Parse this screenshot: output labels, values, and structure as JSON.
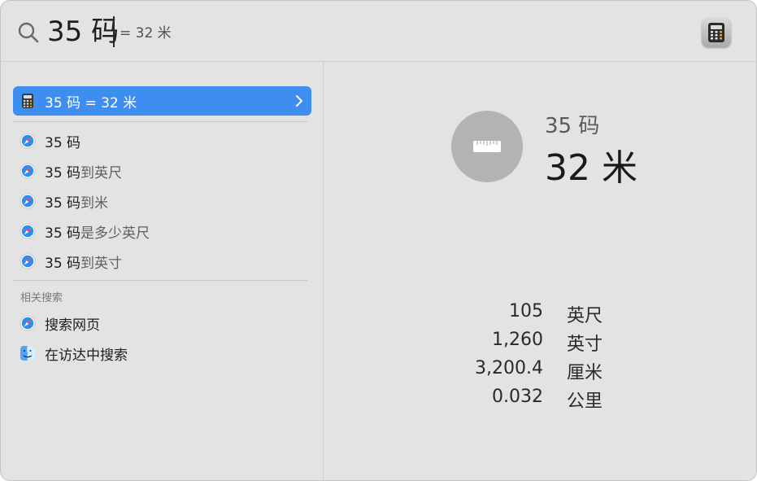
{
  "search": {
    "query": "35 码",
    "inline_result": "= 32 米"
  },
  "top_result": {
    "label": "35 码 = 32 米",
    "icon": "calculator-icon"
  },
  "suggestions": [
    {
      "prefix": "35 码",
      "suffix": "",
      "icon": "safari-icon"
    },
    {
      "prefix": "35 码",
      "suffix": "到英尺",
      "icon": "safari-icon"
    },
    {
      "prefix": "35 码",
      "suffix": "到米",
      "icon": "safari-icon"
    },
    {
      "prefix": "35 码",
      "suffix": "是多少英尺",
      "icon": "safari-icon"
    },
    {
      "prefix": "35 码",
      "suffix": "到英寸",
      "icon": "safari-icon"
    }
  ],
  "related": {
    "section_label": "相关搜索",
    "items": [
      {
        "label": "搜索网页",
        "icon": "safari-icon"
      },
      {
        "label": "在访达中搜索",
        "icon": "finder-icon"
      }
    ]
  },
  "preview": {
    "icon": "ruler-icon",
    "from": "35 码",
    "to": "32 米",
    "conversions": [
      {
        "value": "105",
        "unit": "英尺"
      },
      {
        "value": "1,260",
        "unit": "英寸"
      },
      {
        "value": "3,200.4",
        "unit": "厘米"
      },
      {
        "value": "0.032",
        "unit": "公里"
      }
    ]
  },
  "colors": {
    "selection": "#3d8ef0",
    "window_bg": "#e3e3e3"
  }
}
